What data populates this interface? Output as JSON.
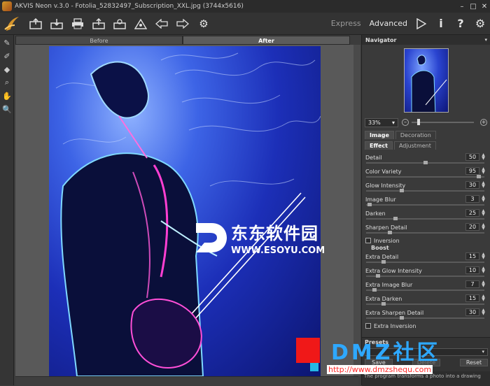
{
  "window": {
    "title": "AKVIS Neon v.3.0 - Fotolia_52832497_Subscription_XXL.jpg (3744x5616)",
    "controls": [
      "minimize",
      "maximize",
      "close"
    ]
  },
  "toolbar": {
    "icons": [
      "open-icon",
      "save-icon",
      "print-icon",
      "share-icon",
      "settings-icon",
      "batch-icon",
      "undo-icon",
      "redo-icon",
      "run-icon"
    ],
    "mode_express": "Express",
    "mode_advanced": "Advanced",
    "right_icons": [
      "run-icon",
      "info-icon",
      "help-icon",
      "preferences-icon"
    ]
  },
  "left_tools": [
    "brush-icon",
    "history-brush-icon",
    "eraser-icon",
    "magnifier-icon",
    "hand-icon",
    "zoom-icon"
  ],
  "view_tabs": {
    "before": "Before",
    "after": "After"
  },
  "navigator": {
    "title": "Navigator",
    "zoom": "33%"
  },
  "panel_tabs": {
    "image": "Image",
    "decoration": "Decoration",
    "effect": "Effect",
    "adjustment": "Adjustment"
  },
  "params": [
    {
      "label": "Detail",
      "value": "50",
      "level": 0.5
    },
    {
      "label": "Color Variety",
      "value": "95",
      "level": 0.95
    },
    {
      "label": "Glow Intensity",
      "value": "30",
      "level": 0.3
    },
    {
      "label": "Image Blur",
      "value": "3",
      "level": 0.03
    },
    {
      "label": "Darken",
      "value": "25",
      "level": 0.25
    },
    {
      "label": "Sharpen Detail",
      "value": "20",
      "level": 0.2
    }
  ],
  "inversion": "Inversion",
  "boost": {
    "title": "Boost",
    "params": [
      {
        "label": "Extra Detail",
        "value": "15",
        "level": 0.15
      },
      {
        "label": "Extra Glow Intensity",
        "value": "10",
        "level": 0.1
      },
      {
        "label": "Extra Image Blur",
        "value": "7",
        "level": 0.07
      },
      {
        "label": "Extra Darken",
        "value": "15",
        "level": 0.15
      },
      {
        "label": "Extra Sharpen Detail",
        "value": "30",
        "level": 0.3
      }
    ],
    "extra_inversion": "Extra Inversion"
  },
  "presets": {
    "title": "Presets",
    "selected": "▾",
    "save": "Save",
    "delete": "Delete",
    "reset": "Reset",
    "hint": "The program transforms a photo into a drawing"
  },
  "watermark": {
    "cn": "东东软件园",
    "url": "WWW.ESOYU.COM"
  },
  "dmz": {
    "title": "DMZ社区",
    "url": "http://www.dmzshequ.com"
  }
}
